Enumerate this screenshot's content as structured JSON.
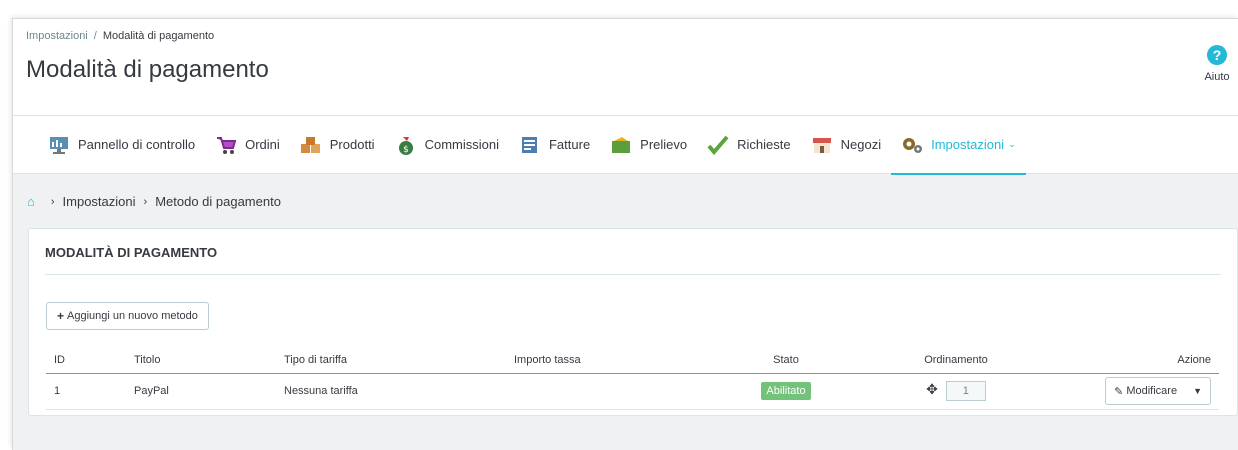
{
  "header": {
    "breadcrumb": [
      "Impostazioni",
      "Modalità di pagamento"
    ],
    "breadcrumb_sep": "/",
    "title": "Modalità di pagamento",
    "help_label": "Aiuto"
  },
  "tabs": [
    {
      "label": "Pannello di controllo",
      "icon": "dashboard-icon"
    },
    {
      "label": "Ordini",
      "icon": "cart-icon"
    },
    {
      "label": "Prodotti",
      "icon": "boxes-icon"
    },
    {
      "label": "Commissioni",
      "icon": "money-bag-icon"
    },
    {
      "label": "Fatture",
      "icon": "invoice-icon"
    },
    {
      "label": "Prelievo",
      "icon": "wallet-icon"
    },
    {
      "label": "Richieste",
      "icon": "checkmark-icon"
    },
    {
      "label": "Negozi",
      "icon": "shop-icon"
    },
    {
      "label": "Impostazioni",
      "icon": "gears-icon",
      "active": true
    }
  ],
  "breadcrumb2": [
    "Impostazioni",
    "Metodo di pagamento"
  ],
  "panel": {
    "title": "MODALITÀ DI PAGAMENTO",
    "add_button": "Aggiungi un nuovo metodo",
    "columns": [
      "ID",
      "Titolo",
      "Tipo di tariffa",
      "Importo tassa",
      "Stato",
      "Ordinamento",
      "Azione"
    ],
    "rows": [
      {
        "id": "1",
        "title": "PayPal",
        "fee_type": "Nessuna tariffa",
        "fee_amount": "",
        "status": "Abilitato",
        "order": "1",
        "action": "Modificare"
      }
    ]
  },
  "colors": {
    "accent": "#25b9d7",
    "enabled": "#72c279"
  }
}
